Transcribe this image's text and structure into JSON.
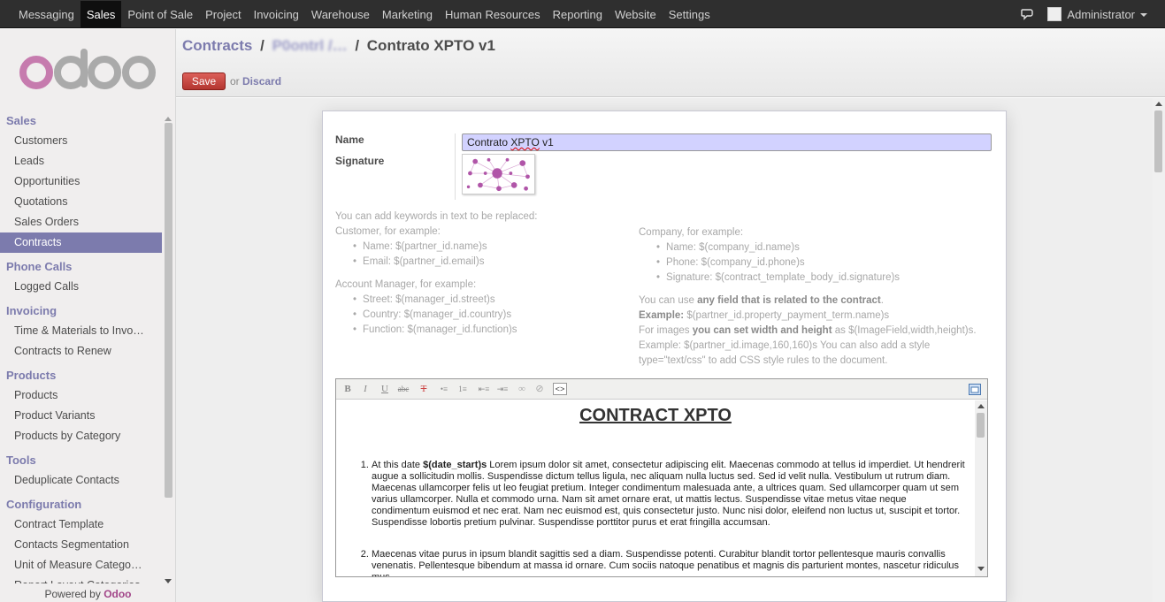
{
  "topbar": {
    "menu": [
      "Messaging",
      "Sales",
      "Point of Sale",
      "Project",
      "Invoicing",
      "Warehouse",
      "Marketing",
      "Human Resources",
      "Reporting",
      "Website",
      "Settings"
    ],
    "active": "Sales",
    "user": "Administrator"
  },
  "sidebar": {
    "sections": [
      {
        "title": "Sales",
        "items": [
          "Customers",
          "Leads",
          "Opportunities",
          "Quotations",
          "Sales Orders",
          "Contracts"
        ]
      },
      {
        "title": "Phone Calls",
        "items": [
          "Logged Calls"
        ]
      },
      {
        "title": "Invoicing",
        "items": [
          "Time & Materials to Invo…",
          "Contracts to Renew"
        ]
      },
      {
        "title": "Products",
        "items": [
          "Products",
          "Product Variants",
          "Products by Category"
        ]
      },
      {
        "title": "Tools",
        "items": [
          "Deduplicate Contacts"
        ]
      },
      {
        "title": "Configuration",
        "items": [
          "Contract Template",
          "Contacts Segmentation",
          "Unit of Measure Catego…",
          "Report Layout Categories"
        ]
      }
    ],
    "active_item": "Contracts",
    "powered_prefix": "Powered by",
    "powered_brand": "Odoo"
  },
  "header": {
    "breadcrumb_root": "Contracts",
    "breadcrumb_blurred": "P0ontrl /…",
    "breadcrumb_current": "Contrato XPTO v1",
    "save_label": "Save",
    "or_label": "or",
    "discard_label": "Discard"
  },
  "form": {
    "name_label": "Name",
    "name_value_prefix": "Contrato ",
    "name_value_squiggle": "XPTO",
    "name_value_suffix": " v1",
    "signature_label": "Signature",
    "help_intro": "You can add keywords in text to be replaced:",
    "customer_title": "Customer, for example:",
    "customer_items": [
      "Name: $(partner_id.name)s",
      "Email: $(partner_id.email)s"
    ],
    "manager_title": "Account Manager, for example:",
    "manager_items": [
      "Street: $(manager_id.street)s",
      "Country: $(manager_id.country)s",
      "Function: $(manager_id.function)s"
    ],
    "company_title": "Company, for example:",
    "company_items": [
      "Name: $(company_id.name)s",
      "Phone: $(company_id.phone)s",
      "Signature: $(contract_template_body_id.signature)s"
    ],
    "any_field_pre": "You can use ",
    "any_field_bold": "any field that is related to the contract",
    "any_field_post": ".",
    "example_label": "Example:",
    "example_value": " $(partner_id.property_payment_term.name)s",
    "images_pre": "For images ",
    "images_bold": "you can set width and height",
    "images_post": " as $(ImageField,width,height)s.",
    "images_example": "Example: $(partner_id.image,160,160)s You can also add a style type=\"text/css\" to add CSS style rules to the document."
  },
  "editor": {
    "toolbar": [
      "B",
      "I",
      "U",
      "abc",
      "T",
      "•≡",
      "1≡",
      "⇤≡",
      "⇥≡",
      "∞",
      "⊘",
      "<>"
    ],
    "heading": "CONTRACT XPTO",
    "p1_pre": "At this date ",
    "p1_bold": "$(date_start)s",
    "p1_post": " Lorem ipsum dolor sit amet, consectetur adipiscing elit. Maecenas commodo at tellus id imperdiet. Ut hendrerit augue a sollicitudin mollis. Suspendisse dictum tellus ligula, nec aliquam nulla luctus sed. Sed id velit nulla. Vestibulum ut rutrum diam. Maecenas ullamcorper felis ut leo feugiat pretium. Integer condimentum malesuada ante, a ultrices quam. Sed ullamcorper quam ut sem varius ullamcorper. Nulla et commodo urna. Nam sit amet ornare erat, ut mattis lectus. Suspendisse vitae metus vitae neque condimentum euismod et nec erat. Nam nec euismod est, quis consectetur justo. Nunc nisi dolor, eleifend non luctus ut, suscipit et tortor. Suspendisse lobortis pretium pulvinar. Suspendisse porttitor purus et erat fringilla accumsan.",
    "p2": "Maecenas vitae purus in ipsum blandit sagittis sed a diam. Suspendisse potenti. Curabitur blandit tortor pellentesque mauris convallis venenatis. Pellentesque bibendum at massa id ornare. Cum sociis natoque penatibus et magnis dis parturient montes, nascetur ridiculus mus."
  },
  "colors": {
    "accent": "#7c7bad",
    "brand": "#a24689",
    "save": "#c9453e",
    "topbar": "#2f2f2f"
  }
}
